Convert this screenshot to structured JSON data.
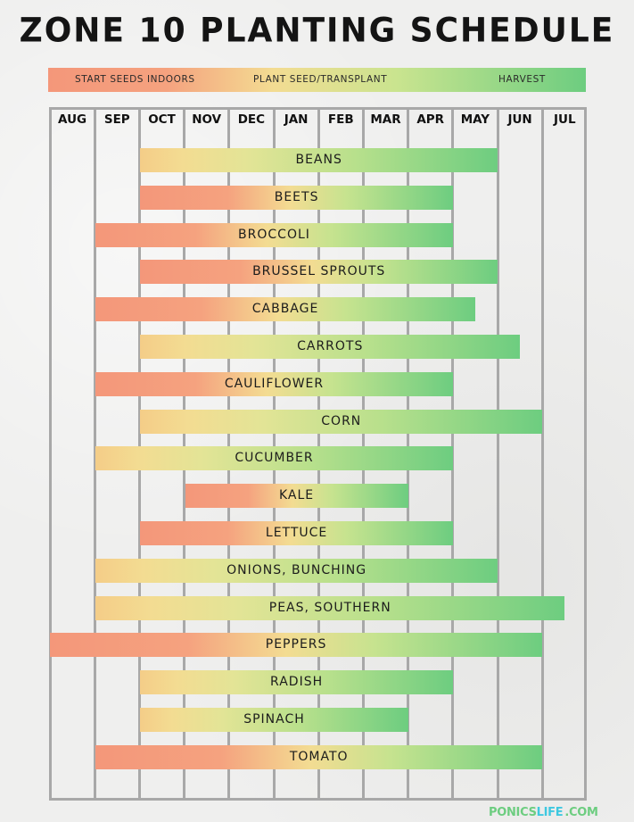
{
  "chart_data": {
    "type": "gantt",
    "title": "ZONE 10 PLANTING SCHEDULE",
    "months": [
      "AUG",
      "SEP",
      "OCT",
      "NOV",
      "DEC",
      "JAN",
      "FEB",
      "MAR",
      "APR",
      "MAY",
      "JUN",
      "JUL"
    ],
    "legend": [
      {
        "label": "START SEEDS INDOORS",
        "color": "#F4977A"
      },
      {
        "label": "PLANT SEED/TRANSPLANT",
        "color": "#F3DC92"
      },
      {
        "label": "HARVEST",
        "color": "#6DCD80"
      }
    ],
    "crops": [
      {
        "name": "BEANS",
        "start_month": "OCT",
        "end_month": "MAY",
        "start": 2,
        "end": 10,
        "begins_with": "plant"
      },
      {
        "name": "BEETS",
        "start_month": "OCT",
        "end_month": "APR",
        "start": 2,
        "end": 9,
        "begins_with": "indoors"
      },
      {
        "name": "BROCCOLI",
        "start_month": "SEP",
        "end_month": "APR",
        "start": 1,
        "end": 9,
        "begins_with": "indoors"
      },
      {
        "name": "BRUSSEL SPROUTS",
        "start_month": "OCT",
        "end_month": "MAY",
        "start": 2,
        "end": 10,
        "begins_with": "indoors"
      },
      {
        "name": "CABBAGE",
        "start_month": "SEP",
        "end_month": "MAY (mid)",
        "start": 1,
        "end": 9.5,
        "begins_with": "indoors"
      },
      {
        "name": "CARROTS",
        "start_month": "OCT",
        "end_month": "JUN (mid)",
        "start": 2,
        "end": 10.5,
        "begins_with": "plant"
      },
      {
        "name": "CAULIFLOWER",
        "start_month": "SEP",
        "end_month": "APR",
        "start": 1,
        "end": 9,
        "begins_with": "indoors"
      },
      {
        "name": "CORN",
        "start_month": "OCT",
        "end_month": "JUN",
        "start": 2,
        "end": 11,
        "begins_with": "plant"
      },
      {
        "name": "CUCUMBER",
        "start_month": "SEP",
        "end_month": "APR",
        "start": 1,
        "end": 9,
        "begins_with": "plant"
      },
      {
        "name": "KALE",
        "start_month": "NOV",
        "end_month": "MAR",
        "start": 3,
        "end": 8,
        "begins_with": "indoors"
      },
      {
        "name": "LETTUCE",
        "start_month": "OCT",
        "end_month": "APR",
        "start": 2,
        "end": 9,
        "begins_with": "indoors"
      },
      {
        "name": "ONIONS, BUNCHING",
        "start_month": "SEP",
        "end_month": "MAY",
        "start": 1,
        "end": 10,
        "begins_with": "plant"
      },
      {
        "name": "PEAS, SOUTHERN",
        "start_month": "SEP",
        "end_month": "JUL (mid)",
        "start": 1,
        "end": 11.5,
        "begins_with": "plant"
      },
      {
        "name": "PEPPERS",
        "start_month": "AUG",
        "end_month": "JUN",
        "start": 0,
        "end": 11,
        "begins_with": "indoors"
      },
      {
        "name": "RADISH",
        "start_month": "OCT",
        "end_month": "APR",
        "start": 2,
        "end": 9,
        "begins_with": "plant"
      },
      {
        "name": "SPINACH",
        "start_month": "OCT",
        "end_month": "MAR",
        "start": 2,
        "end": 8,
        "begins_with": "plant"
      },
      {
        "name": "TOMATO",
        "start_month": "SEP",
        "end_month": "JUN",
        "start": 1,
        "end": 11,
        "begins_with": "indoors"
      }
    ]
  },
  "colors": {
    "indoors": "#F4977A",
    "plant": "#F3DC92",
    "harvest": "#6DCD80",
    "footer_green": "#6DCD80",
    "footer_cyan": "#3FC8E0"
  },
  "footer": {
    "part1": "PONICS",
    "part2": "LIFE",
    "part3": ".COM"
  }
}
